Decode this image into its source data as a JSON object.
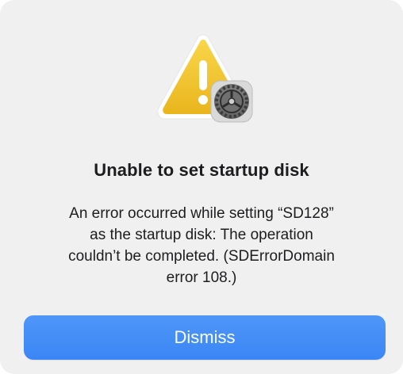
{
  "alert": {
    "title": "Unable to set startup disk",
    "message_lines": [
      "An error occurred while setting “SD128”",
      "as the startup disk: The operation",
      "couldn’t be completed. (SDErrorDomain",
      "error 108.)"
    ],
    "dismiss_label": "Dismiss",
    "icons": {
      "main": "warning-triangle-icon",
      "badge": "system-preferences-gear-icon"
    }
  },
  "colors": {
    "button": "#3a86f5",
    "button_text": "#ffffff",
    "warning_yellow": "#f2c530",
    "background": "#f0f0f0"
  }
}
